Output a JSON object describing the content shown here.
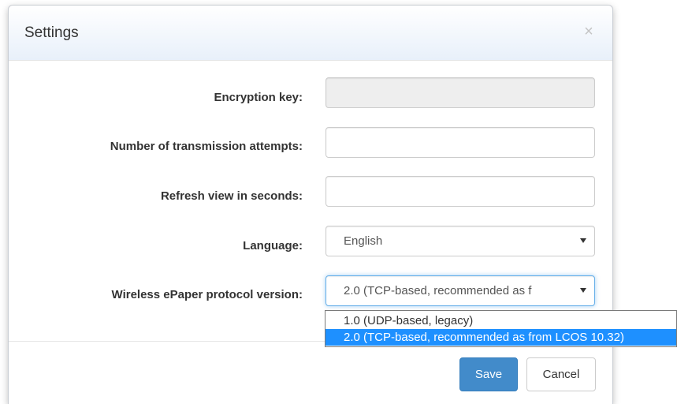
{
  "dialog": {
    "title": "Settings",
    "close_glyph": "×"
  },
  "form": {
    "encryption_key": {
      "label": "Encryption key:",
      "value": "",
      "disabled": true
    },
    "transmission_attempts": {
      "label": "Number of transmission attempts:",
      "value": ""
    },
    "refresh_view": {
      "label": "Refresh view in seconds:",
      "value": ""
    },
    "language": {
      "label": "Language:",
      "selected": "English"
    },
    "protocol_version": {
      "label": "Wireless ePaper protocol version:",
      "selected_display": "2.0 (TCP-based, recommended as f",
      "options": [
        "1.0 (UDP-based, legacy)",
        "2.0 (TCP-based, recommended as from LCOS 10.32)"
      ],
      "highlighted_option": "2.0 (TCP-based, recommended as from LCOS 10.32)"
    }
  },
  "footer": {
    "save_label": "Save",
    "cancel_label": "Cancel"
  },
  "colors": {
    "primary": "#428bca",
    "dropdown_highlight": "#1e90ff",
    "disabled_input": "#eeeeee"
  },
  "icons": {
    "close": "close-icon",
    "select_caret": "chevron-down-icon"
  }
}
